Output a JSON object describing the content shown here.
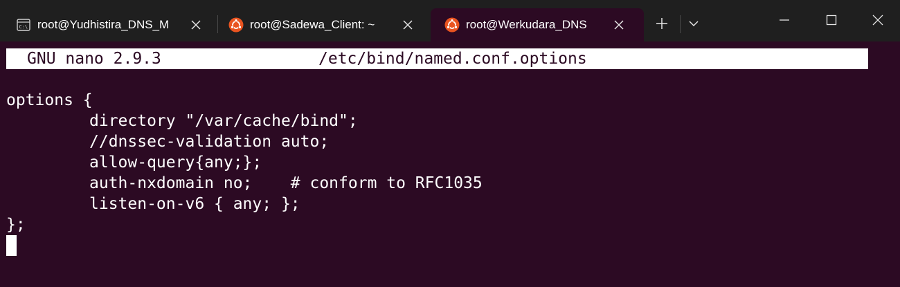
{
  "window": {
    "tabs": [
      {
        "title": "root@Yudhistira_DNS_M",
        "icon": "command-prompt-icon",
        "active": false
      },
      {
        "title": "root@Sadewa_Client: ~",
        "icon": "ubuntu-icon",
        "active": false
      },
      {
        "title": "root@Werkudara_DNS",
        "icon": "ubuntu-icon",
        "active": true
      }
    ],
    "controls": [
      "new-tab-icon",
      "dropdown-chevron-icon",
      "minimize-icon",
      "maximize-icon",
      "close-icon"
    ],
    "colors": {
      "titlebar_bg": "#1f1f1f",
      "terminal_bg": "#2c0a23",
      "ubuntu_orange": "#e95420",
      "text": "#ffffff"
    }
  },
  "nano": {
    "version": "GNU nano 2.9.3",
    "filename": "/etc/bind/named.conf.options"
  },
  "buffer": {
    "lines": [
      {
        "indent": false,
        "text": "options {"
      },
      {
        "indent": true,
        "text": "directory \"/var/cache/bind\";"
      },
      {
        "indent": true,
        "text": "//dnssec-validation auto;"
      },
      {
        "indent": true,
        "text": "allow-query{any;};"
      },
      {
        "indent": true,
        "text": "auth-nxdomain no;    # conform to RFC1035"
      },
      {
        "indent": true,
        "text": "listen-on-v6 { any; };"
      },
      {
        "indent": false,
        "text": "};"
      }
    ]
  }
}
